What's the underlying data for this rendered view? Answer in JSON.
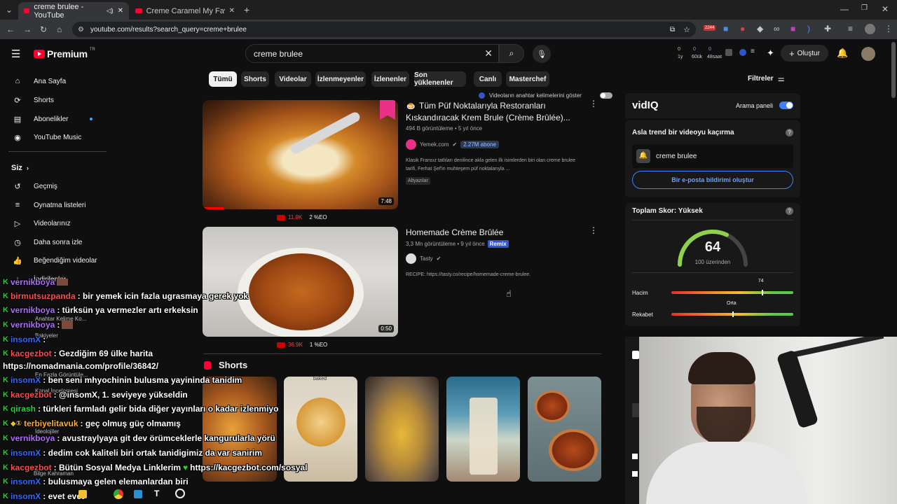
{
  "browser": {
    "tabs": [
      {
        "title": "creme brulee - YouTube",
        "active": true
      },
      {
        "title": "Creme Caramel My Favorite De",
        "active": false
      }
    ],
    "url": "youtube.com/results?search_query=creme+brulee",
    "ext_badge": "2244"
  },
  "youtube": {
    "logo": "Premium",
    "region": "TR",
    "search_value": "creme brulee",
    "create_label": "Oluştur",
    "stats": [
      "0",
      "0",
      "0",
      "1y",
      "60ük",
      "48saat"
    ],
    "sidebar": {
      "items": [
        {
          "icon": "home-icon",
          "label": "Ana Sayfa"
        },
        {
          "icon": "shorts-icon",
          "label": "Shorts"
        },
        {
          "icon": "subscriptions-icon",
          "label": "Abonelikler"
        },
        {
          "icon": "youtube-music-icon",
          "label": "YouTube Music"
        }
      ],
      "you_label": "Siz",
      "you_items": [
        {
          "icon": "history-icon",
          "label": "Geçmiş"
        },
        {
          "icon": "playlists-icon",
          "label": "Oynatma listeleri"
        },
        {
          "icon": "your-videos-icon",
          "label": "Videolarınız"
        },
        {
          "icon": "watch-later-icon",
          "label": "Daha sonra izle"
        },
        {
          "icon": "liked-icon",
          "label": "Beğendiğim videolar"
        },
        {
          "icon": "downloads-icon",
          "label": "İndirilenler"
        }
      ]
    },
    "chips": [
      "Tümü",
      "Shorts",
      "Videolar",
      "İzlenmeyenler",
      "İzlenenler",
      "Son yüklenenler",
      "Canlı",
      "Masterchef"
    ],
    "filters_label": "Filtreler",
    "keyword_toggle_label": "Videoların anahtar kelimelerini göster",
    "videos": [
      {
        "title_line1": "Tüm Püf Noktalarıyla Restoranları",
        "title_line2": "Kıskandıracak Krem Brule (Crème Brûlée)...",
        "meta": "494 B görüntüleme • 5 yıl önce",
        "channel": "Yemek.com",
        "subs": "2.27M abone",
        "desc_line1": "Klasik Fransız tatlıları denilince akla gelen ilk isimlerden biri olan creme brulee",
        "desc_line2": "tarifi, Ferhat Şef'in muhteşem püf noktalarıyla ...",
        "badge": "Altyazılar",
        "duration": "7:48",
        "stat_views": "11.9K",
        "stat_eo": "2 %EO"
      },
      {
        "title_line1": "Homemade Crème Brûlée",
        "meta": "3,3 Mn görüntüleme • 9 yıl önce",
        "remix": "Remix",
        "channel": "Tasty",
        "desc_line1": "RECIPE: https://tasty.co/recipe/homemade-creme-brulee.",
        "duration": "0:50",
        "stat_views": "36.9K",
        "stat_eo": "1 %EO"
      }
    ],
    "shorts_title": "Shorts",
    "shorts_overlay": "baked"
  },
  "vidiq": {
    "logo": "vidIQ",
    "panel_label": "Arama paneli",
    "trend_title": "Asla trend bir videoyu kaçırma",
    "trend_keyword": "creme brulee",
    "alert_button": "Bir e-posta bildirimi oluştur",
    "score_title": "Toplam Skor: Yüksek",
    "score": "64",
    "score_sub": "100 üzerinden",
    "volume_label": "Hacim",
    "volume_value": "74",
    "competition_label": "Rekabet",
    "competition_value": "Orta",
    "volume_fraction": 0.74,
    "competition_fraction": 0.5
  },
  "chat": {
    "messages": [
      {
        "user": "vernikboya",
        "color": "#b06bff",
        "text": ""
      },
      {
        "user": "birmutsuzpanda",
        "color": "#ff4d4d",
        "text": ": bir yemek icin fazla ugrasmaya gerek yok"
      },
      {
        "user": "vernikboya",
        "color": "#b06bff",
        "text": ": türksün ya vermezler artı erkeksin"
      },
      {
        "user": "vernikboya",
        "color": "#b06bff",
        "text": ":"
      },
      {
        "user": "insomX",
        "color": "#2b6bff",
        "text": ":"
      },
      {
        "user": "kacgezbot",
        "color": "#ff4d4d",
        "text": ": Gezdiğim 69 ülke harita"
      },
      {
        "user": "",
        "color": "#ffffff",
        "text": "https://nomadmania.com/profile/36842/"
      },
      {
        "user": "insomX",
        "color": "#2b6bff",
        "text": ": ben seni mhyochinin bulusma yayininda tanidim"
      },
      {
        "user": "kacgezbot",
        "color": "#ff4d4d",
        "text": ": @insomX, 1. seviyeye yükseldin"
      },
      {
        "user": "qirash",
        "color": "#28d03a",
        "text": ": türkleri farmladı gelir bida diğer yayınları o kadar izlenmiyo"
      },
      {
        "user": "terbiyelitavuk",
        "color": "#ffb020",
        "text": ": geç olmuş güç olmamış"
      },
      {
        "user": "vernikboya",
        "color": "#b06bff",
        "text": ": avustraylyaya git dev örümceklerle kangurularla yörü"
      },
      {
        "user": "insomX",
        "color": "#2b6bff",
        "text": ": dedim cok kaliteli biri ortak tanidigimiz da var sanirim"
      },
      {
        "user": "kacgezbot",
        "color": "#ff4d4d",
        "text": ": Bütün Sosyal Medya Linklerim"
      },
      {
        "user": "insomX",
        "color": "#2b6bff",
        "text": ": bulusmaya gelen elemanlardan biri"
      },
      {
        "user": "insomX",
        "color": "#2b6bff",
        "text": ": evet evet"
      }
    ],
    "link": "https://kacgezbot.com/sosyal",
    "ghost": [
      "Anahtar Kelime Ko...",
      "Bakiyeler",
      "En Fazla Görüntüle...",
      "Kanal İncelemesi",
      "İdeolojiler",
      "Bilge Kahraman"
    ]
  }
}
